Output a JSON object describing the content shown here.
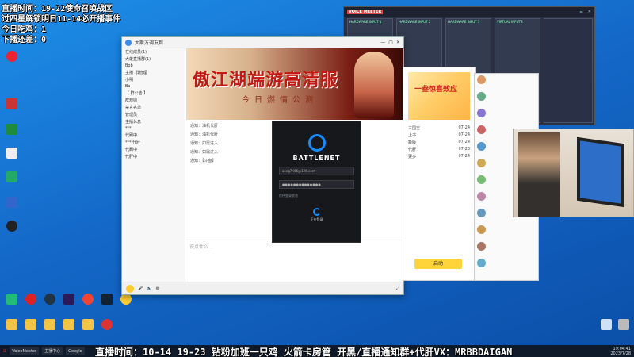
{
  "overlay": {
    "line1": "直播时间：19-22使命召唤战区",
    "line2": "过四星解锁明日11-14必开播事件",
    "line3": "今日吃鸡：1",
    "line4": "下播还差：0",
    "ticker": "直播时间：10-14 19-23 钻粉加班一只鸡 火箭卡房管 开黑/直播通知群+代肝VX：MRBBDAIGAN"
  },
  "desktop_icons": [
    {
      "name": "chrome",
      "label": "",
      "color": "#e23"
    },
    {
      "name": "red-app",
      "label": "",
      "color": "#c33"
    },
    {
      "name": "sheet",
      "label": "",
      "color": "#1e8c3a"
    },
    {
      "name": "doc",
      "label": "",
      "color": "#ddd"
    },
    {
      "name": "word",
      "label": "",
      "color": "#2a6"
    },
    {
      "name": "app-blue",
      "label": "",
      "color": "#36c"
    },
    {
      "name": "obs",
      "label": "",
      "color": "#222"
    }
  ],
  "dock_icons": [
    {
      "name": "icon-a",
      "color": "#2b7"
    },
    {
      "name": "icon-b",
      "color": "#d22"
    },
    {
      "name": "steam",
      "color": "#234"
    },
    {
      "name": "premiere",
      "color": "#2a1a5a"
    },
    {
      "name": "chrome2",
      "color": "#e43"
    },
    {
      "name": "app-a",
      "color": "#123"
    },
    {
      "name": "face",
      "color": "#fc3"
    }
  ],
  "chat": {
    "title": "大斯方调友群",
    "banner_title": "傲江湖端游高清服",
    "banner_sub": "今日燃情公测",
    "input_placeholder": "说点什么...",
    "side_rows": [
      "在线成员(1)",
      "大雄直播群(1)",
      "Bob",
      "主播_群管理",
      "小明",
      "Ba",
      "【 群公告 】",
      "群规则",
      "禁言名单",
      "管理员",
      "主播休息",
      "***",
      "代刷中",
      "*** 代肝",
      "代刷中",
      "代肝中"
    ],
    "messages": [
      "通知：油机代肝",
      "通知：油机代肝",
      "通知：如需进入",
      "通知：如需进入",
      "通知：【斗鱼】"
    ]
  },
  "battlenet": {
    "app_name": "BATTLENET",
    "email_value": "aexg7ri66@126.com",
    "password_value": "●●●●●●●●●●●●●●",
    "keep_logged": "保持登录状态",
    "cancel": "正在登录"
  },
  "rpanel": {
    "promo": "一叁惊喜效应",
    "btn": "启动",
    "rows": [
      {
        "t": "三国志",
        "d": "07-24"
      },
      {
        "t": "上书",
        "d": "07-24"
      },
      {
        "t": "新版",
        "d": "07-24"
      },
      {
        "t": "代肝",
        "d": "07-23"
      },
      {
        "t": "更多",
        "d": "07-24"
      }
    ]
  },
  "voicemeeter": {
    "title": "VOICE MEETER",
    "strips": [
      "HARDWARE INPUT 1",
      "HARDWARE INPUT 2",
      "HARDWARE INPUT 3",
      "VIRTUAL INPUTS"
    ]
  },
  "taskbar": {
    "items": [
      "VoiceMeeter",
      "主播中心",
      "Google"
    ],
    "time": "19:04:41",
    "date": "2023/7/28"
  }
}
